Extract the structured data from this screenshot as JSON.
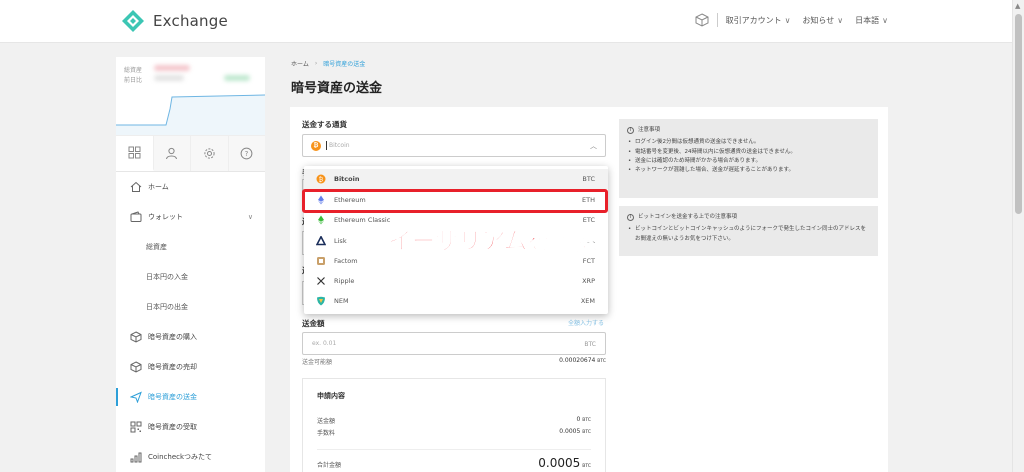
{
  "header": {
    "logo_text": "Exchange",
    "menu": [
      {
        "label": "取引アカウント"
      },
      {
        "label": "お知らせ"
      },
      {
        "label": "日本語"
      }
    ]
  },
  "sidebar": {
    "balance": {
      "label_1": "総資産",
      "label_2": "前日比"
    },
    "tabs": [
      {
        "icon": "grid-icon"
      },
      {
        "icon": "user-icon"
      },
      {
        "icon": "gear-icon"
      },
      {
        "icon": "help-icon"
      }
    ],
    "nav": [
      {
        "label": "ホーム",
        "icon": "home-icon"
      },
      {
        "label": "ウォレット",
        "icon": "wallet-icon"
      },
      {
        "label": "総資産"
      },
      {
        "label": "日本円の入金"
      },
      {
        "label": "日本円の出金"
      },
      {
        "label": "暗号資産の購入",
        "icon": "cube-icon"
      },
      {
        "label": "暗号資産の売却",
        "icon": "cube-icon"
      },
      {
        "label": "暗号資産の送金",
        "icon": "send-icon",
        "active": true
      },
      {
        "label": "暗号資産の受取",
        "icon": "qr-icon"
      },
      {
        "label": "Coincheckつみたて",
        "icon": "chart-icon"
      }
    ]
  },
  "breadcrumb": {
    "home": "ホーム",
    "current": "暗号資産の送金"
  },
  "page_title": "暗号資産の送金",
  "form": {
    "currency_label": "送金する通貨",
    "currency_placeholder": "Bitcoin",
    "ghost_labels": [
      "手",
      "送",
      "送"
    ],
    "amount_label": "送金額",
    "amount_link": "全額入力する",
    "amount_placeholder": "ex. 0.01",
    "amount_unit": "BTC",
    "available_label": "送金可能額",
    "available_value": "0.00020674",
    "available_unit": "BTC"
  },
  "summary": {
    "title": "申請内容",
    "rows": [
      {
        "label": "送金額",
        "value": "0",
        "unit": "BTC"
      },
      {
        "label": "手数料",
        "value": "0.0005",
        "unit": "BTC"
      }
    ],
    "total_label": "合計金額",
    "total_value": "0.0005",
    "total_unit": "BTC"
  },
  "notices": [
    {
      "title": "注意事項",
      "items": [
        "ログイン後2分間は仮想通貨の送金はできません。",
        "電話番号を変更後、24時間以内に仮想通貨の送金はできません。",
        "送金には確認のため時間がかかる場合があります。",
        "ネットワークが混雑した場合、送金が遅延することがあります。"
      ]
    },
    {
      "title": "ビットコインを送金する上での注意事項",
      "items": [
        "ビットコインとビットコインキャッシュのようにフォークで発生したコイン同士のアドレスをお間違えの無いようお気をつけ下さい。"
      ]
    }
  ],
  "dropdown": {
    "options": [
      {
        "name": "Bitcoin",
        "symbol": "BTC",
        "icon": "bitcoin-icon",
        "color": "#f7931a"
      },
      {
        "name": "Ethereum",
        "symbol": "ETH",
        "icon": "ethereum-icon",
        "color": "#627eea"
      },
      {
        "name": "Ethereum Classic",
        "symbol": "ETC",
        "icon": "ethereum-classic-icon",
        "color": "#3ab83a"
      },
      {
        "name": "Lisk",
        "symbol": "LSK",
        "icon": "lisk-icon",
        "color": "#1a2d5a"
      },
      {
        "name": "Factom",
        "symbol": "FCT",
        "icon": "factom-icon",
        "color": "#c9a06a"
      },
      {
        "name": "Ripple",
        "symbol": "XRP",
        "icon": "ripple-icon",
        "color": "#333333"
      },
      {
        "name": "NEM",
        "symbol": "XEM",
        "icon": "nem-icon",
        "color": "#2cb5a6"
      }
    ]
  },
  "annotation": "イーサリアムを選択",
  "colors": {
    "accent": "#2d9fd8",
    "highlight": "#e8202a",
    "annotation": "#f01f29"
  }
}
